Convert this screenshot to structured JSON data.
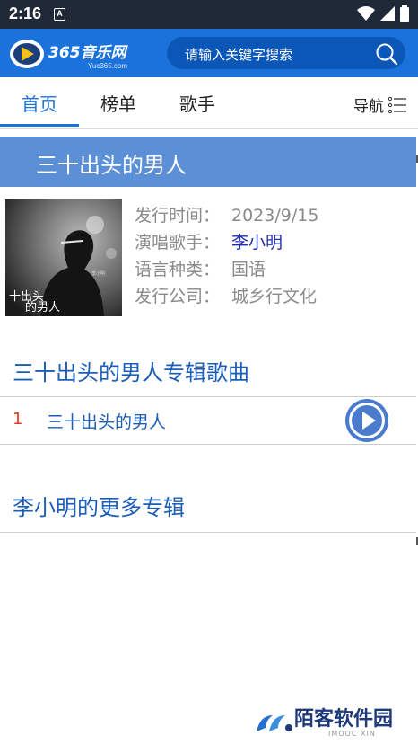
{
  "status_bar": {
    "time": "2:16",
    "notification_icon": "A"
  },
  "header": {
    "logo_main": "365音乐网",
    "logo_sub": "Yuc365.com",
    "search_placeholder": "请输入关键字搜索"
  },
  "tabs": [
    {
      "label": "首页",
      "active": true
    },
    {
      "label": "榜单",
      "active": false
    },
    {
      "label": "歌手",
      "active": false
    }
  ],
  "nav_label": "导航",
  "album": {
    "title": "三十出头的男人",
    "cover_text_line1": "十出头",
    "cover_text_line2": "的男人",
    "cover_artist": "李小明",
    "info": [
      {
        "key": "发行时间：",
        "value": "2023/9/15",
        "link": false
      },
      {
        "key": "演唱歌手：",
        "value": "李小明",
        "link": true
      },
      {
        "key": "语言种类：",
        "value": "国语",
        "link": false
      },
      {
        "key": "发行公司：",
        "value": "城乡行文化",
        "link": false
      }
    ]
  },
  "songs_section": {
    "title": "三十出头的男人专辑歌曲",
    "songs": [
      {
        "number": "1",
        "name": "三十出头的男人"
      }
    ]
  },
  "more_section": {
    "title": "李小明的更多专辑"
  },
  "watermark": {
    "text": "陌客软件园",
    "sub": "IMOOC XIN"
  },
  "colors": {
    "primary": "#1c72db",
    "album_bar": "#5b8fd6",
    "link": "#1b5eb8",
    "number": "#e53b1f"
  }
}
